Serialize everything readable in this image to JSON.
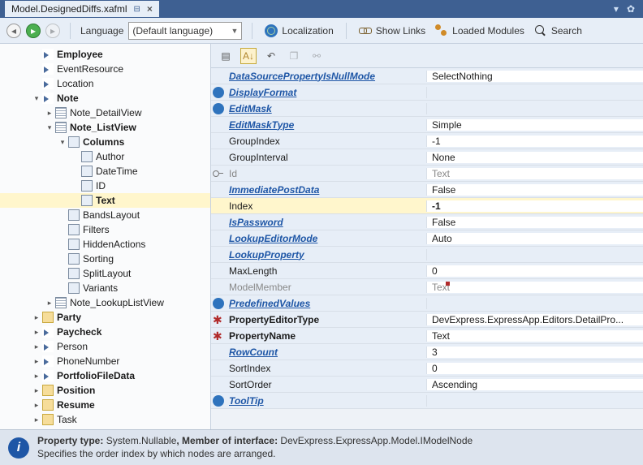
{
  "tab": {
    "filename": "Model.DesignedDiffs.xafml"
  },
  "toolbar": {
    "language_label": "Language",
    "language_value": "(Default language)",
    "localization": "Localization",
    "show_links": "Show Links",
    "loaded_modules": "Loaded Modules",
    "search": "Search"
  },
  "tree": [
    {
      "d": 2,
      "i": "arrow",
      "t": "",
      "label": "Employee",
      "bold": true
    },
    {
      "d": 2,
      "i": "arrow",
      "t": "",
      "label": "EventResource"
    },
    {
      "d": 2,
      "i": "arrow",
      "t": "",
      "label": "Location"
    },
    {
      "d": 2,
      "i": "arrow",
      "t": "▾",
      "label": "Note",
      "bold": true
    },
    {
      "d": 3,
      "i": "pipe",
      "t": "▸",
      "label": "Note_DetailView"
    },
    {
      "d": 3,
      "i": "pipe",
      "t": "▾",
      "label": "Note_ListView",
      "bold": true
    },
    {
      "d": 4,
      "i": "item",
      "t": "▾",
      "label": "Columns",
      "bold": true
    },
    {
      "d": 5,
      "i": "item",
      "t": "",
      "label": "Author"
    },
    {
      "d": 5,
      "i": "item",
      "t": "",
      "label": "DateTime"
    },
    {
      "d": 5,
      "i": "item",
      "t": "",
      "label": "ID"
    },
    {
      "d": 5,
      "i": "item",
      "t": "",
      "label": "Text",
      "bold": true,
      "sel": true
    },
    {
      "d": 4,
      "i": "item",
      "t": "",
      "label": "BandsLayout"
    },
    {
      "d": 4,
      "i": "item",
      "t": "",
      "label": "Filters"
    },
    {
      "d": 4,
      "i": "item",
      "t": "",
      "label": "HiddenActions"
    },
    {
      "d": 4,
      "i": "item",
      "t": "",
      "label": "Sorting"
    },
    {
      "d": 4,
      "i": "item",
      "t": "",
      "label": "SplitLayout"
    },
    {
      "d": 4,
      "i": "item",
      "t": "",
      "label": "Variants"
    },
    {
      "d": 3,
      "i": "pipe",
      "t": "▸",
      "label": "Note_LookupListView"
    },
    {
      "d": 2,
      "i": "folder",
      "t": "▸",
      "label": "Party",
      "bold": true
    },
    {
      "d": 2,
      "i": "arrow",
      "t": "▸",
      "label": "Paycheck",
      "bold": true
    },
    {
      "d": 2,
      "i": "arrow",
      "t": "▸",
      "label": "Person"
    },
    {
      "d": 2,
      "i": "arrow",
      "t": "▸",
      "label": "PhoneNumber"
    },
    {
      "d": 2,
      "i": "arrow",
      "t": "▸",
      "label": "PortfolioFileData",
      "bold": true
    },
    {
      "d": 2,
      "i": "folder",
      "t": "▸",
      "label": "Position",
      "bold": true
    },
    {
      "d": 2,
      "i": "folder",
      "t": "▸",
      "label": "Resume",
      "bold": true
    },
    {
      "d": 2,
      "i": "folder",
      "t": "▸",
      "label": "Task"
    }
  ],
  "props": [
    {
      "name": "DataSourcePropertyIsNullMode",
      "val": "SelectNothing",
      "style": "link"
    },
    {
      "name": "DisplayFormat",
      "val": "",
      "style": "link",
      "icon": "globe"
    },
    {
      "name": "EditMask",
      "val": "",
      "style": "link",
      "icon": "globe"
    },
    {
      "name": "EditMaskType",
      "val": "Simple",
      "style": "link"
    },
    {
      "name": "GroupIndex",
      "val": "-1"
    },
    {
      "name": "GroupInterval",
      "val": "None"
    },
    {
      "name": "Id",
      "val": "Text",
      "style": "dim",
      "icon": "key"
    },
    {
      "name": "ImmediatePostData",
      "val": "False",
      "style": "link"
    },
    {
      "name": "Index",
      "val": "-1",
      "hl": true
    },
    {
      "name": "IsPassword",
      "val": "False",
      "style": "link"
    },
    {
      "name": "LookupEditorMode",
      "val": "Auto",
      "style": "link"
    },
    {
      "name": "LookupProperty",
      "val": "",
      "style": "link"
    },
    {
      "name": "MaxLength",
      "val": "0"
    },
    {
      "name": "ModelMember",
      "val": "Text",
      "style": "dim",
      "right_icon": true
    },
    {
      "name": "PredefinedValues",
      "val": "",
      "style": "link",
      "icon": "globe"
    },
    {
      "name": "PropertyEditorType",
      "val": "DevExpress.ExpressApp.Editors.DetailPro...",
      "style": "req",
      "icon": "star"
    },
    {
      "name": "PropertyName",
      "val": "Text",
      "style": "req",
      "icon": "star"
    },
    {
      "name": "RowCount",
      "val": "3",
      "style": "link"
    },
    {
      "name": "SortIndex",
      "val": "0"
    },
    {
      "name": "SortOrder",
      "val": "Ascending"
    },
    {
      "name": "ToolTip",
      "val": "",
      "style": "link",
      "icon": "globe"
    }
  ],
  "info": {
    "line1_prefix": "Property type: ",
    "line1_type": "System.Nullable",
    "line1_middle": ", Member of interface: ",
    "line1_iface": "DevExpress.ExpressApp.Model.IModelNode",
    "line2": "Specifies the order index by which nodes are arranged."
  }
}
